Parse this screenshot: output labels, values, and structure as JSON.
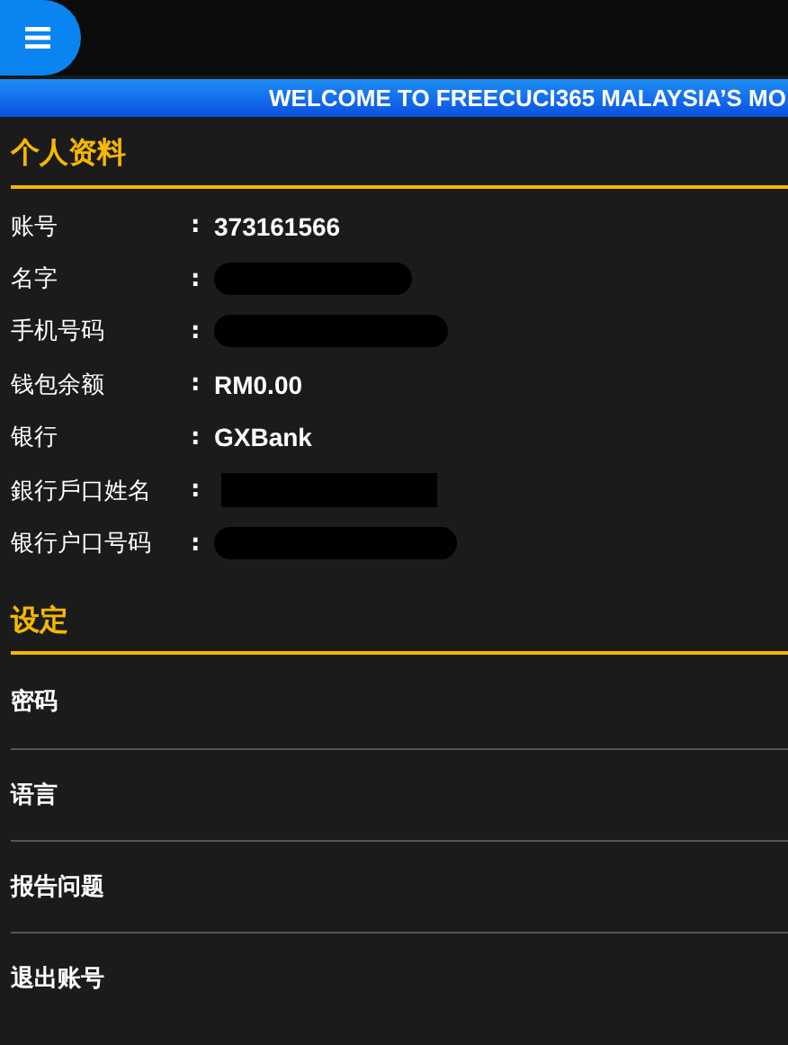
{
  "banner": {
    "text": "WELCOME TO FREECUCI365 MALAYSIA’S MO"
  },
  "profile": {
    "title": "个人资料",
    "rows": [
      {
        "label": "账号",
        "colon": ":",
        "kind": "text",
        "value": "373161566"
      },
      {
        "label": "名字",
        "colon": ":",
        "kind": "redacted_pill"
      },
      {
        "label": "手机号码",
        "colon": ":",
        "kind": "redacted_pill"
      },
      {
        "label": "钱包余额",
        "colon": ":",
        "kind": "text",
        "value": "RM0.00"
      },
      {
        "label": "银行",
        "colon": ":",
        "kind": "text",
        "value": "GXBank"
      },
      {
        "label": "銀行戶口姓名",
        "colon": ":",
        "kind": "redacted_box"
      },
      {
        "label": "银行户口号码",
        "colon": ":",
        "kind": "redacted_pill"
      }
    ]
  },
  "settings": {
    "title": "设定",
    "items": [
      "密码",
      "语言",
      "报告问题",
      "退出账号"
    ]
  }
}
